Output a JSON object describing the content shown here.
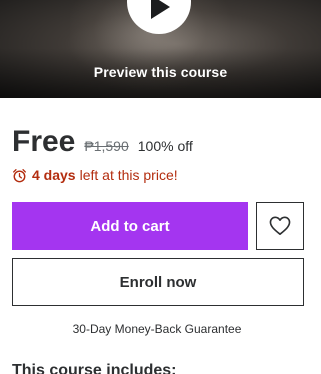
{
  "preview": {
    "label": "Preview this course",
    "play_icon": "play-icon"
  },
  "price": {
    "current": "Free",
    "original": "₱1,590",
    "discount": "100% off"
  },
  "timer": {
    "icon": "alarm-clock-icon",
    "strong": "4 days",
    "rest": "left at this price!"
  },
  "actions": {
    "add_to_cart": "Add to cart",
    "wishlist_icon": "heart-icon",
    "enroll": "Enroll now"
  },
  "guarantee": "30-Day Money-Back Guarantee",
  "includes": {
    "title": "This course includes:"
  },
  "colors": {
    "accent": "#a435f0",
    "urgency": "#b32d0f",
    "text": "#2d2f31"
  }
}
